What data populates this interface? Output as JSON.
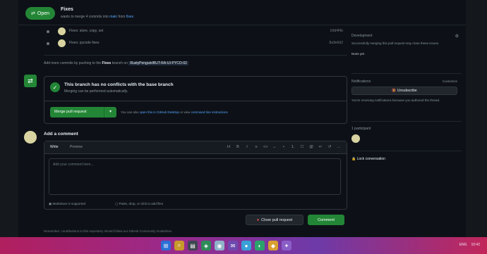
{
  "header": {
    "state_badge": "Open",
    "title": "Fixes",
    "subtitle_prefix": "wants to merge 4 commits into",
    "subtitle_base": "main",
    "subtitle_mid": "from",
    "subtitle_head": "fixes"
  },
  "timeline": {
    "commits": [
      {
        "message": "Fixes: store, copy, set",
        "sha": "b9d4f4b"
      },
      {
        "message": "Fixes: pycode fixes",
        "sha": "8a9e6d2"
      }
    ],
    "info_prefix": "Add more commits by pushing to the",
    "info_branch": "Fixes",
    "info_mid": "branch on",
    "info_repo": "RustyPenguin/BUT-RA-UI-PYCO-02"
  },
  "merge": {
    "title": "This branch has no conflicts with the base branch",
    "description": "Merging can be performed automatically.",
    "button_label": "Merge pull request",
    "hint_prefix": "You can also",
    "hint_link1": "open this in GitHub Desktop",
    "hint_mid": "or view",
    "hint_link2": "command line instructions"
  },
  "comment": {
    "heading": "Add a comment",
    "tab_write": "Write",
    "tab_preview": "Preview",
    "toolbar": [
      "H",
      "B",
      "I",
      "≡",
      "<>",
      "↔",
      "•",
      "1.",
      "☐",
      "@",
      "↵",
      "↺",
      "…"
    ],
    "placeholder": "Add your comment here...",
    "markdown_note": "Markdown is supported",
    "drop_note": "Paste, drop, or click to add files",
    "close_label": "Close pull request",
    "comment_label": "Comment",
    "footnote": "Remember, contributions to this repository should follow our GitHub Community Guidelines."
  },
  "sidebar": {
    "development_title": "Development",
    "development_text": "Successfully merging this pull request may close these issues.",
    "none_yet": "None yet",
    "notifications_title": "Notifications",
    "customize": "Customize",
    "unsubscribe": "Unsubscribe",
    "notifications_text": "You're receiving notifications because you authored the thread.",
    "participants_title": "1 participant",
    "lock_label": "Lock conversation"
  },
  "taskbar": {
    "icons": [
      "windows-logo-icon",
      "search-icon",
      "files-icon",
      "store-icon",
      "browser-icon",
      "mail-icon",
      "chrome-icon",
      "edge-icon",
      "app-icon",
      "settings-icon"
    ],
    "right_items": [
      "ENG",
      "10:42"
    ]
  }
}
